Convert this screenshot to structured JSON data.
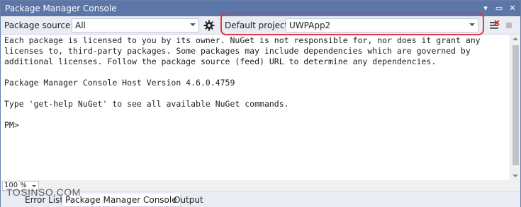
{
  "window": {
    "title": "Package Manager Console",
    "buttons": [
      "▾",
      "▭",
      "✕"
    ]
  },
  "toolbar": {
    "package_source_label": "Package source:",
    "package_source_value": "All",
    "default_project_label": "Default project:",
    "default_project_value": "UWPApp2",
    "highlight_color": "#e0393e"
  },
  "console": {
    "lines": [
      "Each package is licensed to you by its owner. NuGet is not responsible for, nor does it grant any",
      "licenses to, third-party packages. Some packages may include dependencies which are governed by",
      "additional licenses. Follow the package source (feed) URL to determine any dependencies.",
      "",
      "Package Manager Console Host Version 4.6.0.4759",
      "",
      "Type 'get-help NuGet' to see all available NuGet commands.",
      "",
      "PM>"
    ]
  },
  "zoom": {
    "value": "100 %"
  },
  "watermark": "TOSINSO.COM",
  "tabs": [
    {
      "label": "Error List",
      "active": false
    },
    {
      "label": "Package Manager Console",
      "active": true
    },
    {
      "label": "Output",
      "active": false
    }
  ],
  "colors": {
    "title_bar": "#5b76a7",
    "toolbar_bg": "#e9ecf3"
  }
}
